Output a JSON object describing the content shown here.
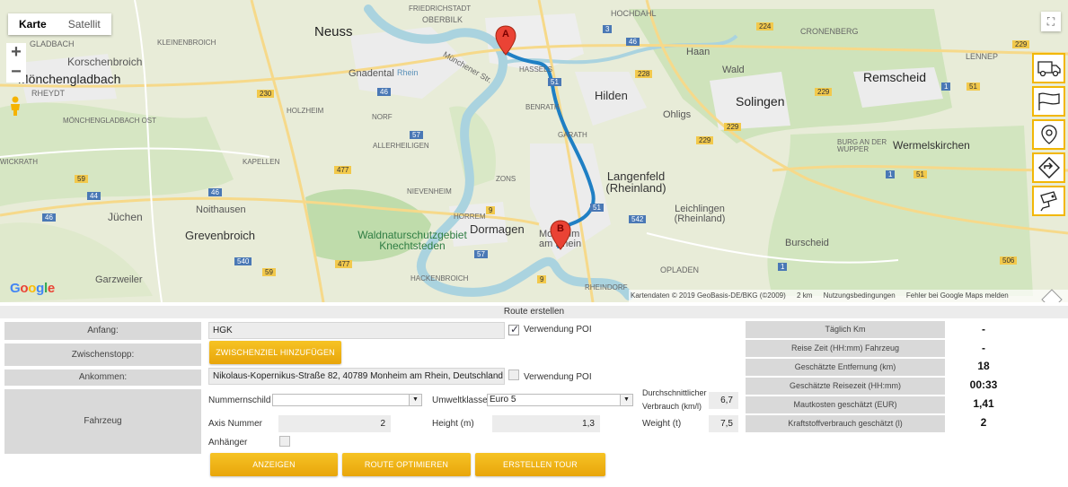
{
  "map": {
    "type_active": "Karte",
    "type_inactive": "Satellit",
    "zoom_in": "+",
    "zoom_out": "−",
    "fullscreen_icon": "fullscreen-icon",
    "google": "Google",
    "attribution": "Kartendaten © 2019 GeoBasis-DE/BKG (©2009)",
    "scale": "2 km",
    "terms": "Nutzungsbedingungen",
    "report": "Fehler bei Google Maps melden",
    "marker_a": "A",
    "marker_b": "B",
    "route_color": "#1f7fc4",
    "labels": {
      "friedrichstadt": "FRIEDRICHSTADT",
      "oberbilk": "OBERBILK",
      "hochdahl": "HOCHDAHL",
      "cronenberg": "CRONENBERG",
      "gladbach": "GLADBACH",
      "kleinenbroich": "KLEINENBROICH",
      "neuss": "Neuss",
      "haan": "Haan",
      "lennep": "LENNEP",
      "korschenbroich": "Korschenbroich",
      "moenchengladbach": "Mönchengladbach",
      "gnadental": "Gnadental",
      "hassels": "HASSELS",
      "wald": "Wald",
      "remscheid": "Remscheid",
      "rheydt": "RHEYDT",
      "hilden": "Hilden",
      "solingen": "Solingen",
      "holzheim": "HOLZHEIM",
      "norf": "NORF",
      "benrath": "BENRATH",
      "ohligs": "Ohligs",
      "mg_ost": "MÖNCHENGLADBACH OST",
      "garath": "GARATH",
      "burg": "BURG AN DER WUPPER",
      "wermelskirchen": "Wermelskirchen",
      "allerheiligen": "ALLERHEILIGEN",
      "wickrath": "WICKRATH",
      "kapellen": "KAPELLEN",
      "zons": "ZONS",
      "langenfeld": "Langenfeld (Rheinland)",
      "nievenheim": "NIEVENHEIM",
      "noithausen": "Noithausen",
      "juechen": "Jüchen",
      "horrem": "HORREM",
      "leichlingen": "Leichlingen (Rheinland)",
      "grevenbroich": "Grevenbroich",
      "dormagen": "Dormagen",
      "waldnatur": "Waldnaturschutzgebiet Knechtsteden",
      "burscheid": "Burscheid",
      "monheim": "Monheim am Rhein",
      "garzweiler": "Garzweiler",
      "opladen": "OPLADEN",
      "hackenbroich": "HACKENBROICH",
      "rheindorf": "RHEINDORF",
      "rhein": "Rhein",
      "muenchener": "Münchener Str.",
      "r46": "46",
      "r230": "230",
      "r57": "57",
      "r477": "477",
      "r59": "59",
      "r44": "44",
      "r540": "540",
      "r9": "9",
      "r51": "51",
      "r542": "542",
      "r228": "228",
      "r229": "229",
      "r224": "224",
      "r506": "506",
      "r1": "1",
      "r3": "3"
    }
  },
  "tools": [
    "truck-icon",
    "flag-icon",
    "pin-icon",
    "direction-icon",
    "camera-icon"
  ],
  "form": {
    "section_title": "Route erstellen",
    "labels": {
      "anfang": "Anfang:",
      "zwischenstopp": "Zwischenstopp:",
      "ankommen": "Ankommen:",
      "fahrzeug": "Fahrzeug"
    },
    "anfang_value": "HGK",
    "poi_label": "Verwendung POI",
    "zwischenziel_button": "ZWISCHENZIEL HINZUFÜGEN",
    "ankommen_value": "Nikolaus-Kopernikus-Straße 82, 40789 Monheim am Rhein, Deutschland",
    "nummernschild_label": "Nummernschild",
    "umweltklasse_label": "Umweltklasse",
    "umweltklasse_value": "Euro 5",
    "verbrauch_label_1": "Durchschnittlicher",
    "verbrauch_label_2": "Verbrauch (km/l)",
    "verbrauch_value": "6,7",
    "axis_label": "Axis Nummer",
    "axis_value": "2",
    "height_label": "Height (m)",
    "height_value": "1,3",
    "weight_label": "Weight (t)",
    "weight_value": "7,5",
    "anhaenger_label": "Anhänger",
    "buttons": {
      "anzeigen": "ANZEIGEN",
      "optimieren": "ROUTE OPTIMIEREN",
      "tour": "ERSTELLEN TOUR"
    }
  },
  "stats": [
    {
      "label": "Täglich Km",
      "value": "-"
    },
    {
      "label": "Reise Zeit (HH:mm) Fahrzeug",
      "value": "-"
    },
    {
      "label": "Geschätzte Entfernung (km)",
      "value": "18"
    },
    {
      "label": "Geschätzte Reisezeit (HH:mm)",
      "value": "00:33"
    },
    {
      "label": "Mautkosten geschätzt (EUR)",
      "value": "1,41"
    },
    {
      "label": "Kraftstoffverbrauch geschätzt (l)",
      "value": "2"
    }
  ]
}
